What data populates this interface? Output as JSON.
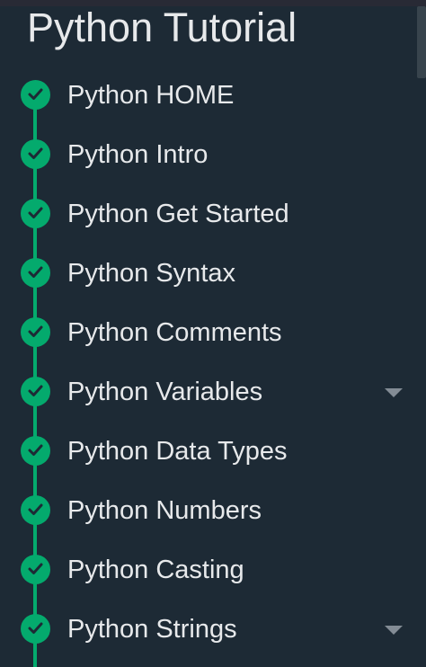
{
  "sidebar": {
    "title": "Python Tutorial",
    "accent_color": "#04aa6d",
    "background_color": "#1d2a35",
    "items": [
      {
        "label": "Python HOME",
        "completed": true,
        "has_submenu": false
      },
      {
        "label": "Python Intro",
        "completed": true,
        "has_submenu": false
      },
      {
        "label": "Python Get Started",
        "completed": true,
        "has_submenu": false
      },
      {
        "label": "Python Syntax",
        "completed": true,
        "has_submenu": false
      },
      {
        "label": "Python Comments",
        "completed": true,
        "has_submenu": false
      },
      {
        "label": "Python Variables",
        "completed": true,
        "has_submenu": true
      },
      {
        "label": "Python Data Types",
        "completed": true,
        "has_submenu": false
      },
      {
        "label": "Python Numbers",
        "completed": true,
        "has_submenu": false
      },
      {
        "label": "Python Casting",
        "completed": true,
        "has_submenu": false
      },
      {
        "label": "Python Strings",
        "completed": true,
        "has_submenu": true
      }
    ],
    "icons": {
      "completed": "check-circle-icon",
      "submenu": "caret-down-icon"
    }
  }
}
